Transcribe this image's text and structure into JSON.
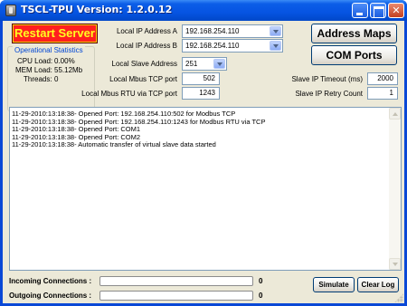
{
  "window": {
    "title": "TSCL-TPU   Version: 1.2.0.12"
  },
  "restart_button": "Restart Server",
  "stats": {
    "caption": "Operational Statistics",
    "cpu_label": "CPU Load:",
    "cpu_value": "0.00%",
    "mem_label": "MEM Load:",
    "mem_value": "55.12Mb",
    "threads_label": "Threads:",
    "threads_value": "0"
  },
  "fields": {
    "ip_a_label": "Local IP Address A",
    "ip_a_value": "192.168.254.110",
    "ip_b_label": "Local IP Address B",
    "ip_b_value": "192.168.254.110",
    "slave_label": "Local Slave Address",
    "slave_value": "251",
    "tcp_port_label": "Local Mbus TCP port",
    "tcp_port_value": "502",
    "rtu_port_label": "Local Mbus RTU via TCP port",
    "rtu_port_value": "1243",
    "timeout_label": "Slave IP Timeout (ms)",
    "timeout_value": "2000",
    "retry_label": "Slave IP Retry Count",
    "retry_value": "1"
  },
  "buttons": {
    "address_maps": "Address Maps",
    "com_ports": "COM Ports",
    "simulate": "Simulate",
    "clear_log": "Clear Log"
  },
  "log": [
    "11-29-2010:13:18:38- Opened Port: 192.168.254.110:502 for Modbus TCP",
    "11-29-2010:13:18:38- Opened Port: 192.168.254.110:1243 for Modbus RTU via TCP",
    "11-29-2010:13:18:38- Opened Port: COM1",
    "11-29-2010:13:18:38- Opened Port: COM2",
    "11-29-2010:13:18:38- Automatic transfer of virtual slave data started"
  ],
  "connections": {
    "incoming_label": "Incoming Connections :",
    "incoming_count": "0",
    "incoming_progress": 0,
    "outgoing_label": "Outgoing Connections :",
    "outgoing_count": "0",
    "outgoing_progress": 0
  },
  "colors": {
    "restart_bg": "#ff1f1f",
    "restart_text": "#ffff20",
    "stats_caption": "#0046d5"
  }
}
